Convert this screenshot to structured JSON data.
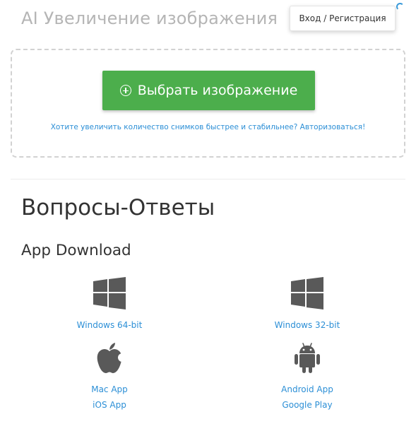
{
  "header": {
    "app_title": "AI Увеличение изображения",
    "login_label": "Вход / Регистрация"
  },
  "upload": {
    "choose_button": "Выбрать изображение",
    "hint_link": "Хотите увеличить количество снимков быстрее и стабильнее? Авторизоваться!"
  },
  "faq": {
    "heading": "Вопросы-Ответы"
  },
  "downloads": {
    "heading": "App Download",
    "windows64": {
      "label": "Windows 64-bit",
      "icon": "windows-icon"
    },
    "windows32": {
      "label": "Windows 32-bit",
      "icon": "windows-icon"
    },
    "mac": {
      "label": "Mac App",
      "icon": "apple-icon"
    },
    "ios": {
      "label": "iOS App"
    },
    "android": {
      "label": "Android App",
      "icon": "android-icon"
    },
    "google_play": {
      "label": "Google Play"
    }
  },
  "colors": {
    "accent_green": "#4cae4c",
    "link_blue": "#2c8fd6",
    "icon_gray": "#595959",
    "title_gray": "#b5b5b5"
  }
}
